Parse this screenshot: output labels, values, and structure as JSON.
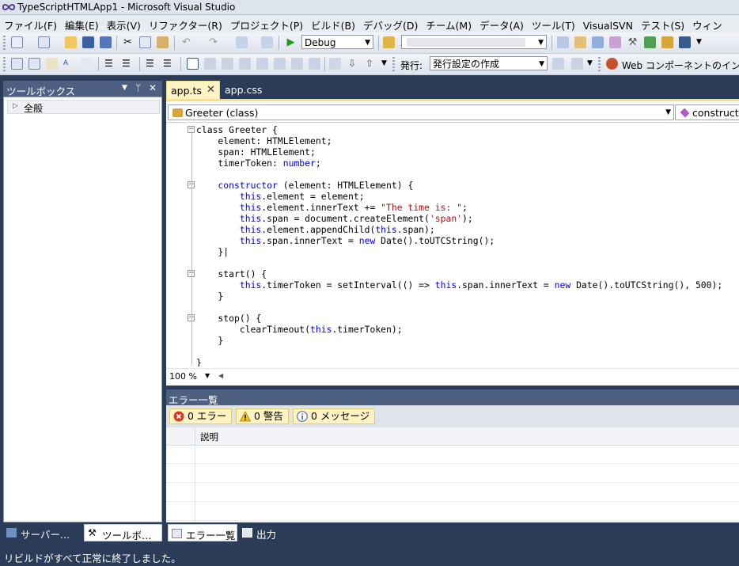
{
  "window": {
    "title": "TypeScriptHTMLApp1 - Microsoft Visual Studio"
  },
  "menu": [
    "ファイル(F)",
    "編集(E)",
    "表示(V)",
    "リファクター(R)",
    "プロジェクト(P)",
    "ビルド(B)",
    "デバッグ(D)",
    "チーム(M)",
    "データ(A)",
    "ツール(T)",
    "VisualSVN",
    "テスト(S)",
    "ウィン"
  ],
  "toolbar": {
    "configuration": "Debug",
    "platform": "",
    "publish_label": "発行:",
    "publish_value": "発行設定の作成",
    "web_component": "Web コンポーネントのイン"
  },
  "toolbox": {
    "title": "ツールボックス",
    "group": "全般",
    "controls": {
      "dropdown": "▼",
      "pin": "ᛘ",
      "close": "✕"
    }
  },
  "doc_tabs": [
    {
      "label": "app.ts",
      "close": "✕"
    },
    {
      "label": "app.css"
    }
  ],
  "navbar": {
    "type": "Greeter (class)",
    "member": "constructor"
  },
  "code_lines": [
    [
      [
        "tx",
        "class Greeter {"
      ]
    ],
    [
      [
        "tx",
        "    element: HTMLElement;"
      ]
    ],
    [
      [
        "tx",
        "    span: HTMLElement;"
      ]
    ],
    [
      [
        "tx",
        "    timerToken: "
      ],
      [
        "kw",
        "number"
      ],
      [
        "tx",
        ";"
      ]
    ],
    [
      [
        "tx",
        ""
      ]
    ],
    [
      [
        "kw",
        "    constructor"
      ],
      [
        "tx",
        " (element: HTMLElement) {"
      ]
    ],
    [
      [
        "kw",
        "        this"
      ],
      [
        "tx",
        ".element = element;"
      ]
    ],
    [
      [
        "kw",
        "        this"
      ],
      [
        "tx",
        ".element.innerText += "
      ],
      [
        "st",
        "\"The time is: \""
      ],
      [
        "tx",
        ";"
      ]
    ],
    [
      [
        "kw",
        "        this"
      ],
      [
        "tx",
        ".span = document.createElement("
      ],
      [
        "st",
        "'span'"
      ],
      [
        "tx",
        ");"
      ]
    ],
    [
      [
        "kw",
        "        this"
      ],
      [
        "tx",
        ".element.appendChild("
      ],
      [
        "kw",
        "this"
      ],
      [
        "tx",
        ".span);"
      ]
    ],
    [
      [
        "kw",
        "        this"
      ],
      [
        "tx",
        ".span.innerText = "
      ],
      [
        "kw",
        "new"
      ],
      [
        "tx",
        " Date().toUTCString();"
      ]
    ],
    [
      [
        "tx",
        "    }|"
      ]
    ],
    [
      [
        "tx",
        ""
      ]
    ],
    [
      [
        "tx",
        "    start() {"
      ]
    ],
    [
      [
        "kw",
        "        this"
      ],
      [
        "tx",
        ".timerToken = setInterval(() => "
      ],
      [
        "kw",
        "this"
      ],
      [
        "tx",
        ".span.innerText = "
      ],
      [
        "kw",
        "new"
      ],
      [
        "tx",
        " Date().toUTCString(), 500);"
      ]
    ],
    [
      [
        "tx",
        "    }"
      ]
    ],
    [
      [
        "tx",
        ""
      ]
    ],
    [
      [
        "tx",
        "    stop() {"
      ]
    ],
    [
      [
        "tx",
        "        clearTimeout("
      ],
      [
        "kw",
        "this"
      ],
      [
        "tx",
        ".timerToken);"
      ]
    ],
    [
      [
        "tx",
        "    }"
      ]
    ],
    [
      [
        "tx",
        ""
      ]
    ],
    [
      [
        "tx",
        "}"
      ]
    ]
  ],
  "editor": {
    "zoom": "100 %"
  },
  "error_list": {
    "title": "エラー一覧",
    "errors": "0 エラー",
    "warnings": "0 警告",
    "messages": "0 メッセージ",
    "column_description": "説明"
  },
  "bottom_tabs": {
    "server": "サーバー…",
    "toolbox": "ツールボ…",
    "errors": "エラー一覧",
    "output": "出力"
  },
  "status": "リビルドがすべて正常に終了しました。"
}
